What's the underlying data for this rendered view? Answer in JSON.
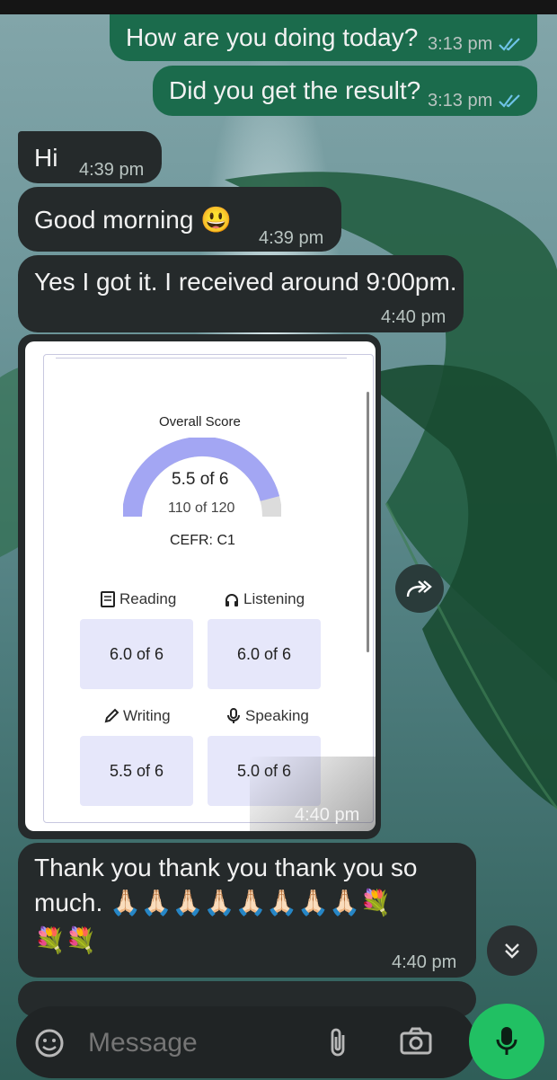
{
  "colors": {
    "outgoing_bubble": "#1b6b4c",
    "incoming_bubble": "#252a2b",
    "mic_button": "#21c063",
    "gauge_fill": "#a3a6f3",
    "score_box": "#e6e7fa"
  },
  "messages": [
    {
      "direction": "outgoing",
      "text": "How are you doing today?",
      "time": "3:13 pm",
      "status_icon": "double-check-icon"
    },
    {
      "direction": "outgoing",
      "text": "Did you get the result?",
      "time": "3:13 pm",
      "status_icon": "double-check-icon"
    },
    {
      "direction": "incoming",
      "text": "Hi",
      "time": "4:39 pm"
    },
    {
      "direction": "incoming",
      "text": "Good morning 😃",
      "time": "4:39 pm"
    },
    {
      "direction": "incoming",
      "text": "Yes I got it. I received around 9:00pm.",
      "time": "4:40 pm"
    },
    {
      "direction": "incoming",
      "type": "image",
      "time": "4:40 pm"
    },
    {
      "direction": "incoming",
      "text_line1": "Thank you thank you thank you so",
      "text_line2": "much. 🙏🏻🙏🏻🙏🏻🙏🏻🙏🏻🙏🏻🙏🏻🙏🏻💐",
      "text_line3": "💐💐",
      "time": "4:40 pm"
    }
  ],
  "score_card": {
    "title": "Overall Score",
    "overall_fraction": 0.917,
    "score": "5.5 of 6",
    "points": "110 of 120",
    "cefr": "CEFR: C1",
    "skills": [
      {
        "name": "Reading",
        "icon": "book-icon",
        "score": "6.0 of 6"
      },
      {
        "name": "Listening",
        "icon": "headphones-icon",
        "score": "6.0 of 6"
      },
      {
        "name": "Writing",
        "icon": "pencil-icon",
        "score": "5.5 of 6"
      },
      {
        "name": "Speaking",
        "icon": "microphone-icon",
        "score": "5.0 of 6"
      }
    ]
  },
  "composer": {
    "placeholder": "Message",
    "icons": [
      "sticker-icon",
      "paperclip-icon",
      "camera-icon",
      "mic-icon"
    ]
  },
  "floating": {
    "forward_icon": "forward-icon",
    "scroll_down_icon": "double-chevron-down-icon"
  }
}
